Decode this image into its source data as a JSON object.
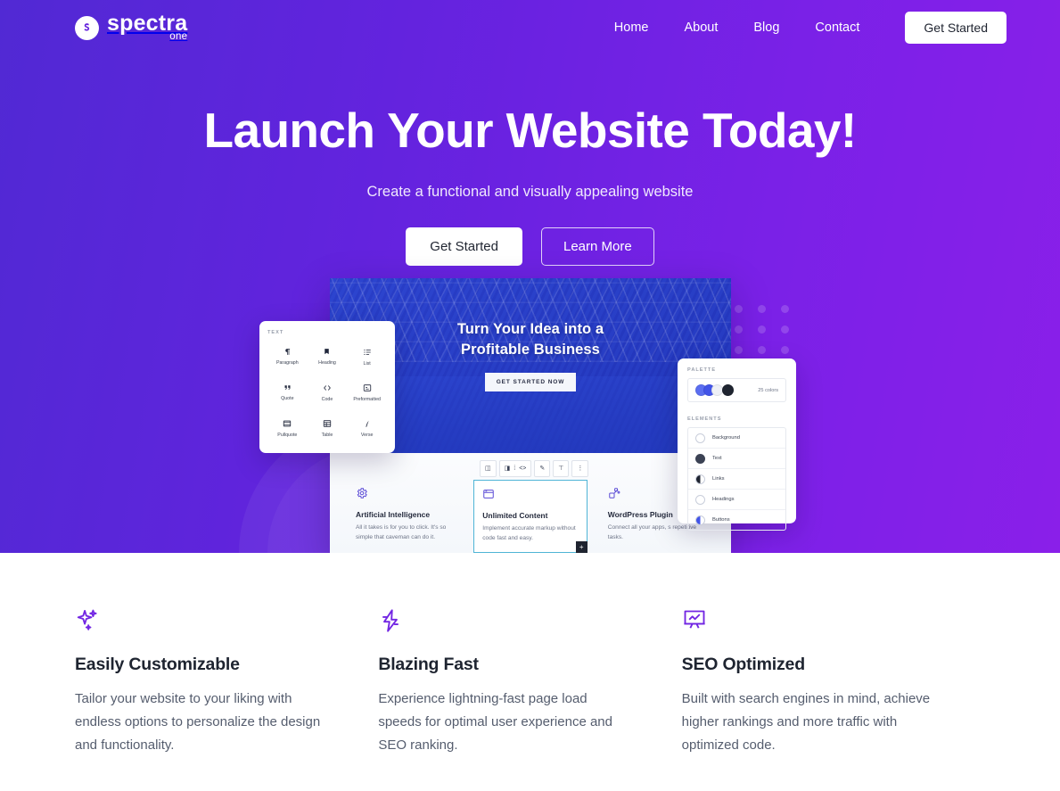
{
  "brand": {
    "name": "spectra",
    "sub": "one",
    "mark_icon": "spectra-s-logo-icon"
  },
  "nav": {
    "links": [
      {
        "label": "Home"
      },
      {
        "label": "About"
      },
      {
        "label": "Blog"
      },
      {
        "label": "Contact"
      }
    ],
    "cta_label": "Get Started"
  },
  "hero": {
    "title": "Launch Your Website Today!",
    "subtitle": "Create a functional and visually appealing website",
    "primary_button": "Get Started",
    "secondary_button": "Learn More"
  },
  "mockup": {
    "banner_title_line1": "Turn Your Idea into a",
    "banner_title_line2": "Profitable Business",
    "banner_button": "GET STARTED NOW",
    "toolbar_icons": [
      "layout-icon",
      "align-icon",
      "drag-handle-icon",
      "code-icon",
      "brush-icon",
      "vertical-align-icon",
      "more-options-icon"
    ],
    "cards": [
      {
        "icon": "gear-icon",
        "title": "Artificial Intelligence",
        "text": "All it takes is for you to click. It's so simple that caveman can do it."
      },
      {
        "icon": "window-icon",
        "title": "Unlimited Content",
        "text": "Implement accurate markup without code fast and easy.",
        "active": true,
        "badge": "+"
      },
      {
        "icon": "plugin-icon",
        "title": "WordPress Plugin",
        "text": "Connect all your apps, s repetitive tasks."
      }
    ],
    "blocks_panel": {
      "label": "TEXT",
      "items": [
        {
          "icon": "paragraph-icon",
          "label": "Paragraph"
        },
        {
          "icon": "heading-icon",
          "label": "Heading"
        },
        {
          "icon": "list-icon",
          "label": "List"
        },
        {
          "icon": "quote-icon",
          "label": "Quote"
        },
        {
          "icon": "code-icon",
          "label": "Code"
        },
        {
          "icon": "preformatted-icon",
          "label": "Preformatted"
        },
        {
          "icon": "pullquote-icon",
          "label": "Pullquote"
        },
        {
          "icon": "table-icon",
          "label": "Table"
        },
        {
          "icon": "verse-icon",
          "label": "Verse"
        }
      ]
    },
    "palette_panel": {
      "label": "PALETTE",
      "count_label": "25 colors",
      "elements_label": "ELEMENTS",
      "elements": [
        {
          "label": "Background",
          "swatch": "empty"
        },
        {
          "label": "Text",
          "swatch": "dark"
        },
        {
          "label": "Links",
          "swatch": "half-dark"
        },
        {
          "label": "Headings",
          "swatch": "outline"
        },
        {
          "label": "Buttons",
          "swatch": "half-blue"
        }
      ]
    }
  },
  "features": [
    {
      "icon": "sparkles-icon",
      "title": "Easily Customizable",
      "text": "Tailor your website to your liking with endless options to personalize the design and functionality."
    },
    {
      "icon": "lightning-bolt-icon",
      "title": "Blazing Fast",
      "text": "Experience lightning-fast page load speeds for optimal user experience and SEO ranking."
    },
    {
      "icon": "presentation-chart-icon",
      "title": "SEO Optimized",
      "text": "Built with search engines in mind, achieve higher rankings and more traffic with optimized code."
    }
  ],
  "colors": {
    "brand_purple": "#7226e3",
    "hero_gradient_start": "#5129d4",
    "hero_gradient_end": "#8a1fe9",
    "heading_dark": "#1e2430",
    "body_gray": "#555d6e"
  }
}
